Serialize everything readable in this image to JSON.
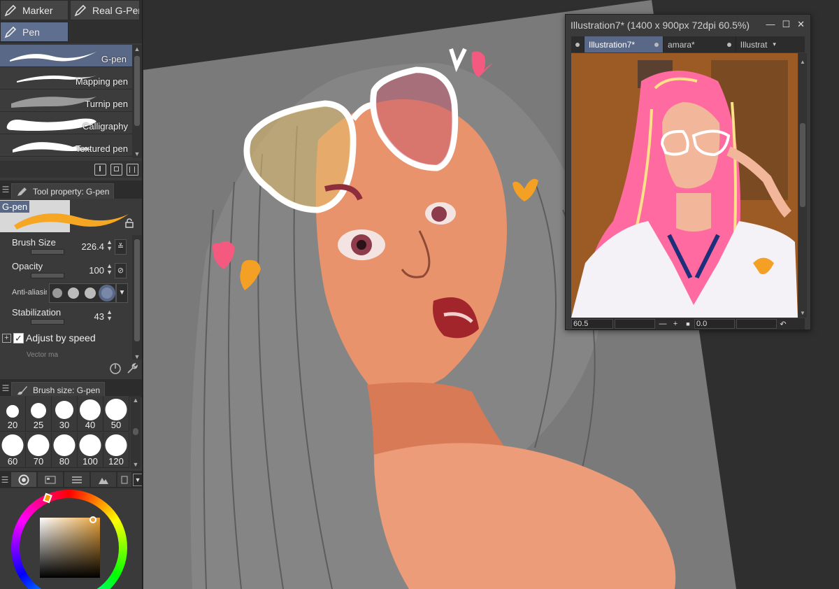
{
  "subtool_tabs": {
    "marker": "Marker",
    "real_gpen": "Real G-Pen",
    "pen": "Pen"
  },
  "brushes": [
    {
      "name": "G-pen",
      "selected": true
    },
    {
      "name": "Mapping pen",
      "selected": false
    },
    {
      "name": "Turnip pen",
      "selected": false
    },
    {
      "name": "Calligraphy",
      "selected": false
    },
    {
      "name": "Textured pen",
      "selected": false
    }
  ],
  "tool_property": {
    "tab_label": "Tool property: G-pen",
    "preview_name": "G-pen",
    "brush_size_label": "Brush Size",
    "brush_size_value": "226.4",
    "opacity_label": "Opacity",
    "opacity_value": "100",
    "antialias_label": "Anti-aliasing",
    "stabilization_label": "Stabilization",
    "stabilization_value": "43",
    "adjust_by_speed_label": "Adjust by speed",
    "adjust_by_speed_checked": true,
    "vector_label": "Vector ma"
  },
  "brush_size_panel": {
    "tab_label": "Brush size: G-pen",
    "sizes": [
      "20",
      "25",
      "30",
      "40",
      "50",
      "60",
      "70",
      "80",
      "100",
      "120"
    ]
  },
  "navigator": {
    "title": "Illustration7* (1400 x 900px 72dpi 60.5%)",
    "tabs": [
      "Illustration7*",
      "amara*",
      "Illustrat"
    ],
    "zoom_value": "60.5",
    "rotation_value": "0.0"
  },
  "colors": {
    "accent_selected": "#5a6888",
    "panel_bg": "#3a3a3a",
    "canvas_gray": "#7a7a7a",
    "brush_stroke_preview": "#f5a623",
    "main_color": "#e8a33b"
  },
  "icons": {
    "pen_tool": "pen-icon",
    "save_brush": "download-icon",
    "duplicate_brush": "duplicate-icon",
    "delete_brush": "trash-icon",
    "lock": "lock-icon",
    "settings": "wrench-icon",
    "dial": "dial-icon"
  }
}
